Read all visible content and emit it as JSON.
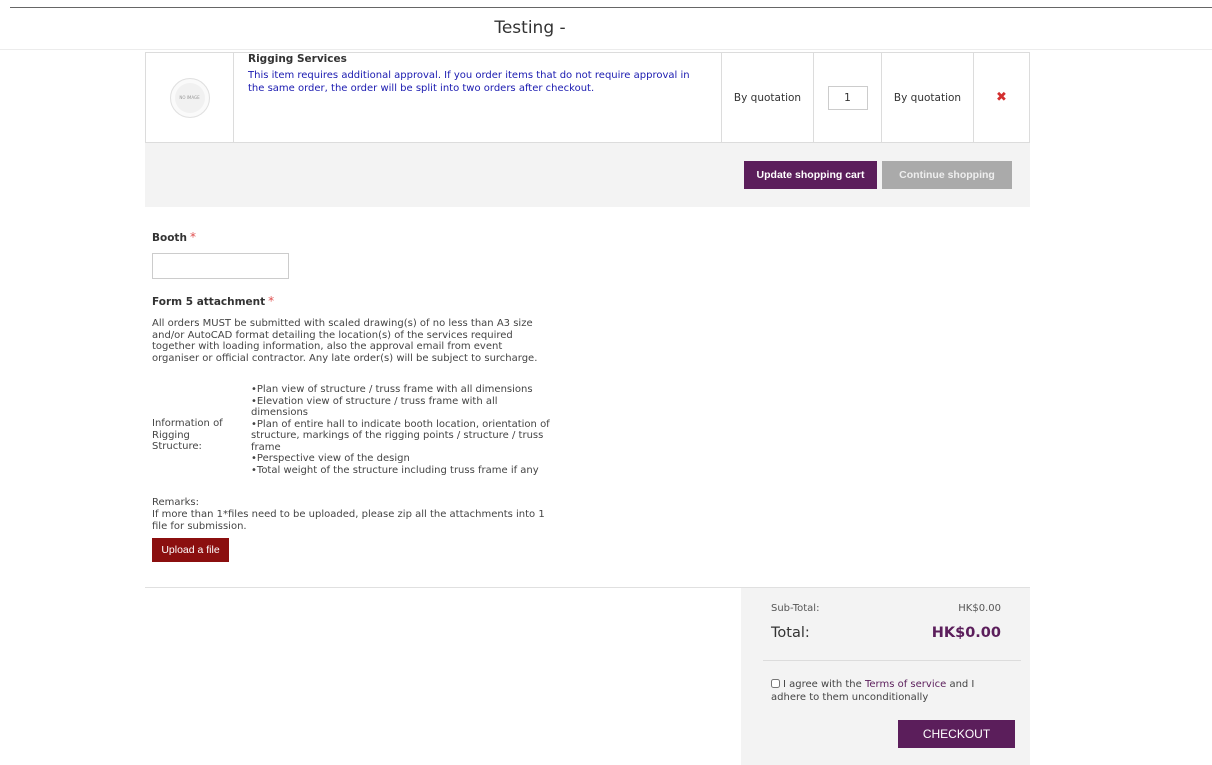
{
  "page": {
    "title": "Testing -"
  },
  "cart": {
    "item": {
      "image_alt": "NO IMAGE",
      "name": "Rigging Services",
      "note": "This item requires additional approval. If you order items that do not require approval in the same order, the order will be split into two orders after checkout.",
      "price": "By quotation",
      "quantity": "1",
      "total": "By quotation",
      "remove_symbol": "✖"
    },
    "update_label": "Update shopping cart",
    "continue_label": "Continue shopping"
  },
  "form": {
    "booth_label": "Booth",
    "required_mark": "*",
    "booth_value": "",
    "attachment_label": "Form 5 attachment",
    "attachment_desc": "All orders MUST be submitted with scaled drawing(s) of no less than A3 size and/or AutoCAD format detailing the location(s) of the services required together with loading information, also the approval email from event organiser or official contractor. Any late order(s) will be subject to surcharge.",
    "info_label": "Information of Rigging Structure:",
    "info_items": [
      "Plan view of structure / truss frame with all dimensions",
      "Elevation view of structure / truss frame with all dimensions",
      "Plan of entire hall to indicate booth location, orientation of structure, markings of the rigging points / structure / truss frame",
      "Perspective view of the design",
      "Total weight of the structure including truss frame if any"
    ],
    "remarks_title": "Remarks:",
    "remarks_text": "If more than 1*files need to be uploaded, please zip all the attachments into 1 file for submission.",
    "upload_label": "Upload a file"
  },
  "totals": {
    "subtotal_label": "Sub-Total:",
    "subtotal_value": "HK$0.00",
    "total_label": "Total:",
    "total_value": "HK$0.00",
    "agree_prefix": "I agree with the",
    "terms_link": "Terms of service",
    "agree_suffix": "and I adhere to them unconditionally",
    "checkout_label": "CHECKOUT"
  },
  "colors": {
    "accent": "#5b1e5b",
    "upload": "#8b0f0f",
    "note_blue": "#1a1ab0",
    "remove_red": "#d32f2f"
  }
}
